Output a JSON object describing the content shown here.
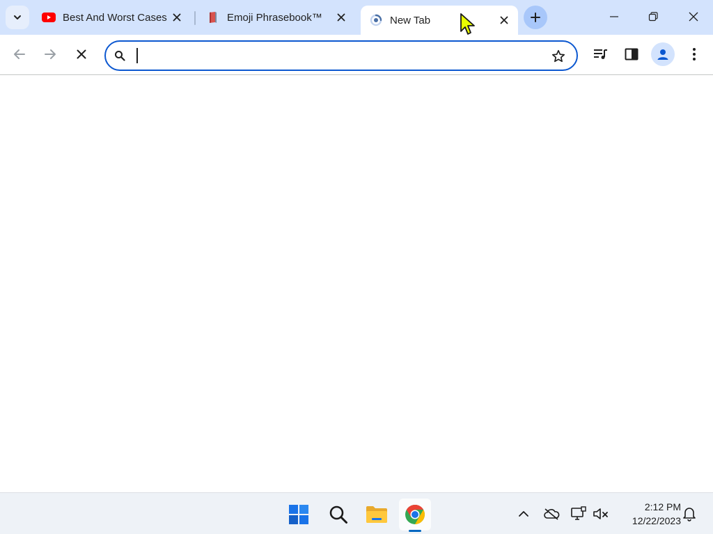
{
  "tabs": [
    {
      "title": "Best And Worst Cases",
      "favicon": "youtube-icon",
      "active": false
    },
    {
      "title": "Emoji Phrasebook™",
      "favicon": "book-icon",
      "active": false
    },
    {
      "title": "New Tab",
      "favicon": "loading-spinner-icon",
      "active": true
    }
  ],
  "toolbar": {
    "back_icon": "arrow-left-icon",
    "forward_icon": "arrow-right-icon",
    "stop_icon": "close-icon",
    "omnibox_value": "",
    "omnibox_placeholder": "",
    "bookmark_icon": "star-outline-icon",
    "extra_icons": [
      "media-control-icon",
      "side-panel-icon",
      "profile-icon",
      "more-vert-icon"
    ]
  },
  "taskbar": {
    "apps": [
      "windows-start-icon",
      "search-icon",
      "file-explorer-icon",
      "chrome-icon"
    ],
    "tray": [
      "chevron-up-icon",
      "onedrive-icon",
      "network-icon",
      "speaker-muted-icon",
      "bell-icon"
    ],
    "time": "2:12 PM",
    "date": "12/22/2023"
  },
  "colors": {
    "tab_strip": "#d3e3fd",
    "accent": "#0b57d0",
    "youtube_red": "#ff0000",
    "pointer": "#eaff00"
  }
}
